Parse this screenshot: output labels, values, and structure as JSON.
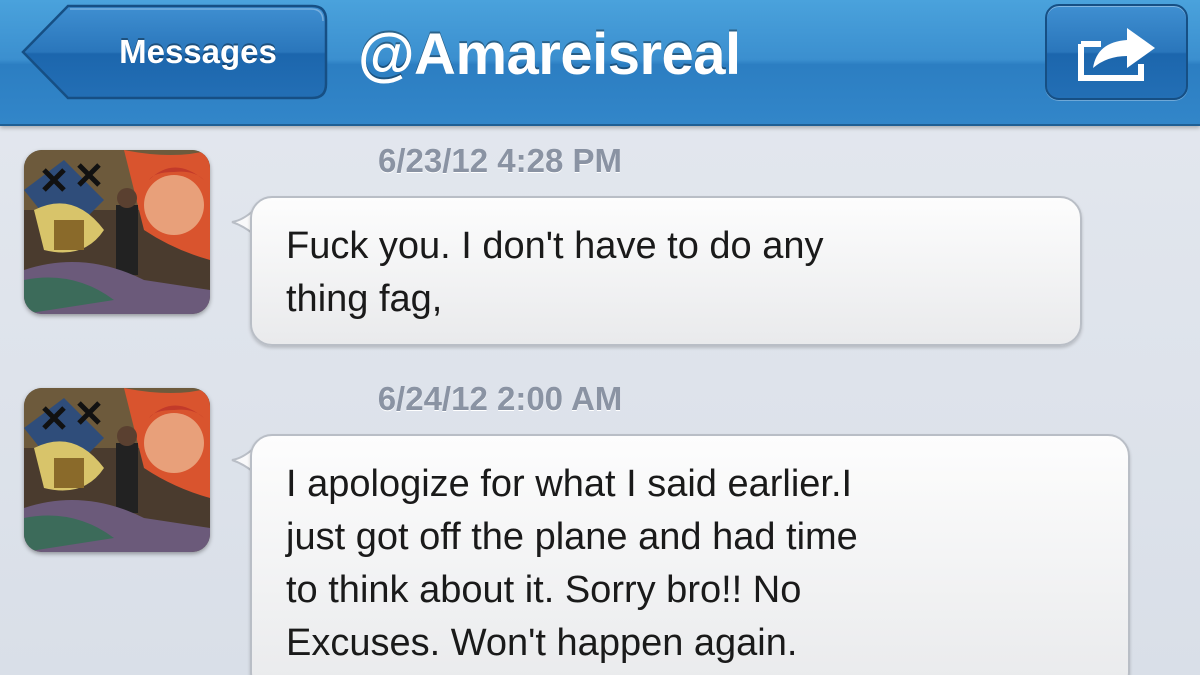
{
  "navbar": {
    "back_label": "Messages",
    "title": "@Amareisreal",
    "share_icon": "share-arrow-icon",
    "color": "#3b8fcf"
  },
  "messages": [
    {
      "timestamp": "6/23/12 4:28 PM",
      "text": "Fuck you. I don't have to do any\nthing fag,"
    },
    {
      "timestamp": "6/24/12 2:00 AM",
      "text": "I apologize for what I said earlier.I\njust got off the plane and had time\nto think about it. Sorry bro!! No\nExcuses. Won't happen again."
    }
  ]
}
